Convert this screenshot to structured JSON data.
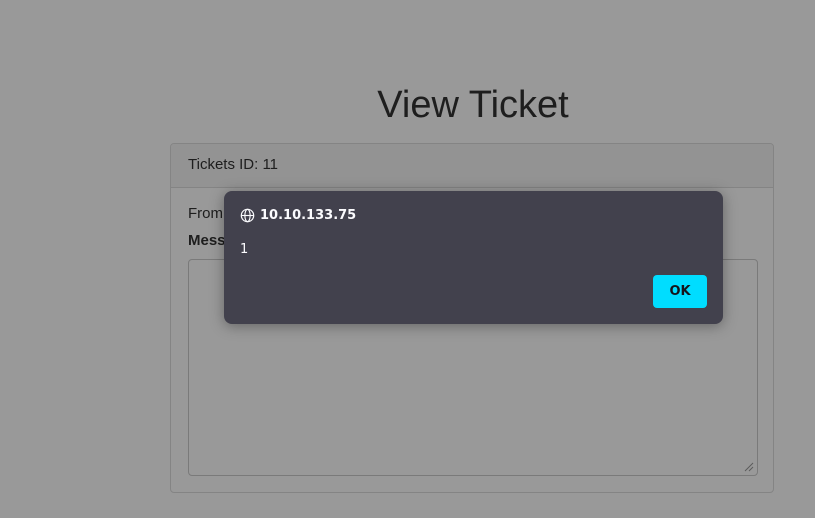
{
  "page": {
    "title": "View Ticket"
  },
  "ticket": {
    "id_label": "Tickets ID: 11",
    "from_label": "From",
    "message_label": "Message",
    "message_value": ""
  },
  "alert_dialog": {
    "origin": "10.10.133.75",
    "origin_icon": "globe-icon",
    "message": "1",
    "ok_label": "OK",
    "accent_color": "#00ddff",
    "background_color": "#42414d"
  }
}
